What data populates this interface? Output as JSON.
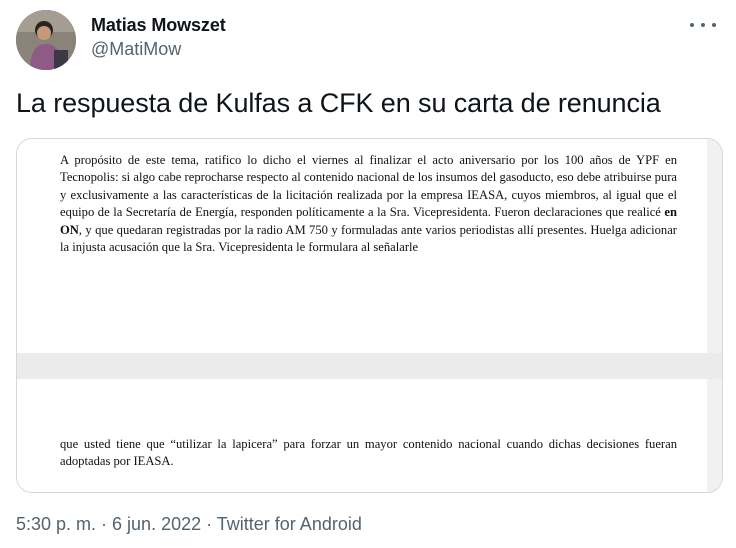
{
  "author": {
    "name": "Matias Mowszet",
    "handle": "@MatiMow"
  },
  "tweet": {
    "text": "La respuesta de Kulfas a CFK en su carta de renuncia"
  },
  "document": {
    "paragraph1_part1": "A propósito de este tema, ratifico lo dicho el viernes al finalizar el acto aniversario por los 100 años de YPF en Tecnopolis: si algo cabe reprocharse respecto al contenido nacional de los insumos del gasoducto, eso debe atribuirse pura y exclusivamente a las características de la licitación realizada por la empresa IEASA, cuyos miembros, al igual que el equipo de la Secretaría de Energía, responden políticamente a la Sra. Vicepresidenta. Fueron declaraciones que realicé ",
    "paragraph1_bold": "en ON",
    "paragraph1_part2": ", y que quedaran registradas por la radio AM 750 y formuladas ante varios periodistas allí presentes. Huelga adicionar la injusta acusación que la Sra. Vicepresidenta le formulara al señalarle",
    "paragraph2": "que usted tiene que “utilizar la lapicera” para forzar un mayor contenido nacional cuando dichas decisiones fueran adoptadas por IEASA."
  },
  "meta": {
    "timestamp": "5:30 p. m. · 6 jun. 2022 · Twitter for Android"
  },
  "icons": {
    "more": "more-horizontal-icon"
  }
}
